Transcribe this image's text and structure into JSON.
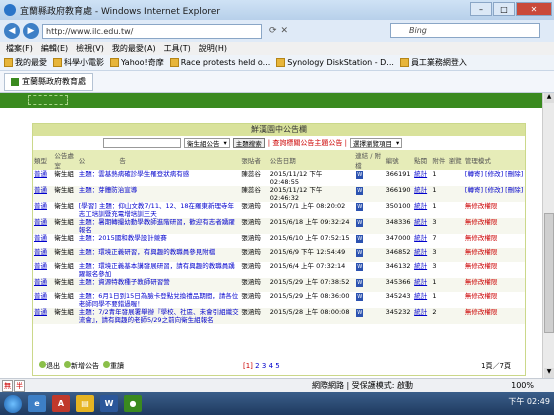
{
  "window": {
    "title": "宜蘭縣政府教育處 - Windows Internet Explorer"
  },
  "address": {
    "url": "http://www.ilc.edu.tw/",
    "search_placeholder": "Bing"
  },
  "menu": [
    "檔案(F)",
    "編輯(E)",
    "檢視(V)",
    "我的最愛(A)",
    "工具(T)",
    "說明(H)"
  ],
  "favorites": [
    "我的最愛",
    "科學小電影",
    "Yahoo!奇摩",
    "Race protests held o...",
    "Synology DiskStation - D...",
    "員工業務網登入"
  ],
  "tab": {
    "label": "宜蘭縣政府教育處"
  },
  "panel": {
    "title": "鮮漢園中公告欄",
    "filter_select": "衛生組公告",
    "search_button": "主題搜索",
    "links": "| 查詢標關公告主題公告 |",
    "option_select": "選擇瀏覽項目"
  },
  "table": {
    "headers": [
      "類型",
      "公告處室",
      "公",
      "告",
      "張貼者",
      "公告日期",
      "連結 / 附檔",
      "編號",
      "點閱",
      "附件",
      "瀏覽",
      "管理模式"
    ],
    "rows": [
      {
        "type": "普通",
        "office": "衛生組",
        "subject": "主題：雲基熱病確診學生罹登狀病有感",
        "poster": "陳蕊谷",
        "date": "2015/11/12 下午 02:48:55",
        "id": "366191",
        "stat": "統計",
        "files": "1",
        "mgmt": "[轉寄] [修改] [刪除]"
      },
      {
        "type": "普通",
        "office": "衛生組",
        "subject": "主題：芽體防治宣導",
        "poster": "陳蕊谷",
        "date": "2015/11/12 下午 02:46:32",
        "id": "366190",
        "stat": "統計",
        "files": "1",
        "mgmt": "[轉寄] [修改] [刪除]"
      },
      {
        "type": "普通",
        "office": "衛生組",
        "subject": "[學習] 主題：仰山文教7/11、12、18在羅東新理寺年志工培訓暨充電增培訓三天",
        "poster": "張涵筠",
        "date": "2015/7/1 上午 08:20:02",
        "id": "350100",
        "stat": "統計",
        "files": "1",
        "mgmt": "無修改權限"
      },
      {
        "type": "普通",
        "office": "衛生組",
        "subject": "主題：暑期轉撮幼動學教師進階研習，歡迎有志者踴躍報名",
        "poster": "張涵筠",
        "date": "2015/6/18 上午 09:32:24",
        "id": "348336",
        "stat": "統計",
        "files": "3",
        "mgmt": "無修改權限"
      },
      {
        "type": "普通",
        "office": "衛生組",
        "subject": "主題：2015國和教學設計競賽",
        "poster": "張涵筠",
        "date": "2015/6/10 上午 07:52:15",
        "id": "347000",
        "stat": "統計",
        "files": "7",
        "mgmt": "無修改權限"
      },
      {
        "type": "普通",
        "office": "衛生組",
        "subject": "主題：環境正義研習，有興趣的教職員參見附檔",
        "poster": "張涵筠",
        "date": "2015/6/9 下午 12:54:49",
        "id": "346852",
        "stat": "統計",
        "files": "3",
        "mgmt": "無修改權限"
      },
      {
        "type": "普通",
        "office": "衛生組",
        "subject": "主題：環境正義基本講發展研習，請有興趣的教職員踴躍報名參加",
        "poster": "張涵筠",
        "date": "2015/6/4 上午 07:32:14",
        "id": "346132",
        "stat": "統計",
        "files": "3",
        "mgmt": "無修改權限"
      },
      {
        "type": "普通",
        "office": "衛生組",
        "subject": "主題：資源特教種子教師研習營",
        "poster": "張涵筠",
        "date": "2015/5/29 上午 07:38:52",
        "id": "345366",
        "stat": "統計",
        "files": "1",
        "mgmt": "無修改權限"
      },
      {
        "type": "普通",
        "office": "衛生組",
        "subject": "主題：6月1日到15日為臉卡登點兌換禮品期間，請各位老師同學不要錯過喔！",
        "poster": "張涵筠",
        "date": "2015/5/29 上午 08:36:00",
        "id": "345243",
        "stat": "統計",
        "files": "1",
        "mgmt": "無修改權限"
      },
      {
        "type": "普通",
        "office": "衛生組",
        "subject": "主題：7/2青年發展署舉辦『學校、社區、未會引組織交流會』，請有興趣的老師5/29之前向衛生組報名",
        "poster": "張涵筠",
        "date": "2015/5/28 上午 08:00:08",
        "id": "345232",
        "stat": "統計",
        "files": "2",
        "mgmt": "無修改權限"
      }
    ]
  },
  "footer": {
    "exit": "退出",
    "new_post": "新增公告",
    "orderby": "重讀",
    "pages": [
      "[1]",
      "2",
      "3",
      "4",
      "5"
    ],
    "page_count": "1頁／7頁"
  },
  "statusbar": {
    "zone": "網際網路 | 受保護模式: 啟動",
    "zoom": "100%"
  },
  "taskbar": {
    "time": "下午 02:49"
  },
  "ime": [
    "無",
    "半"
  ]
}
